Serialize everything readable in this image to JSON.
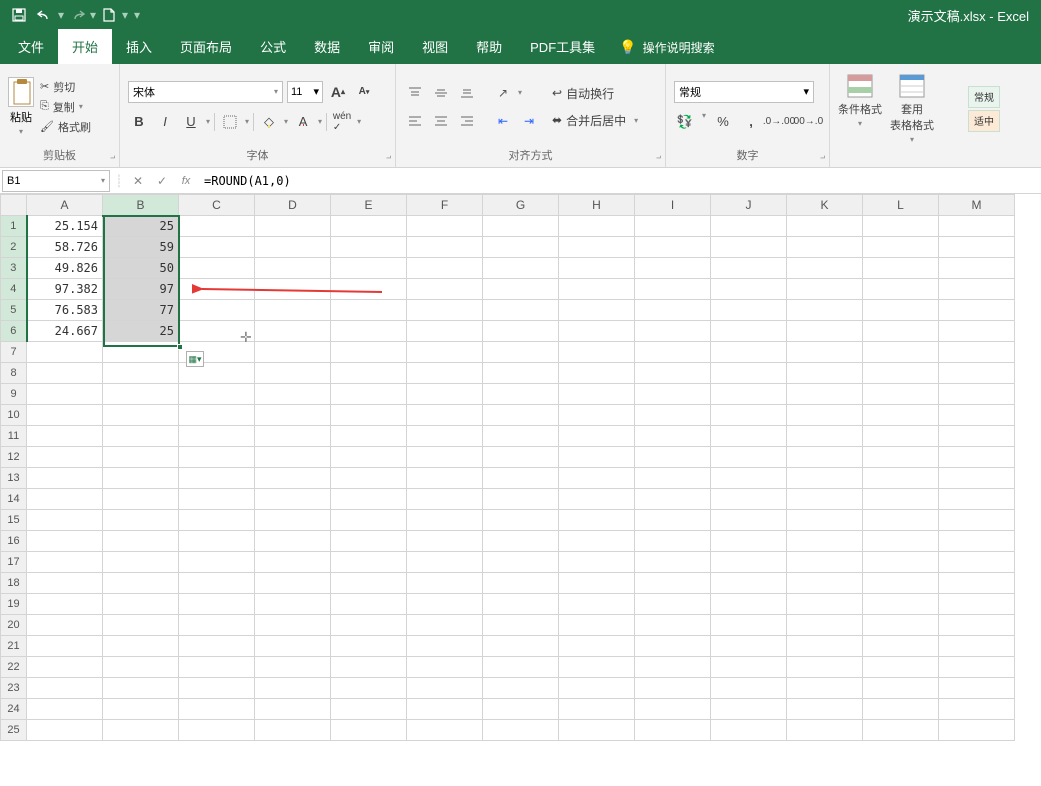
{
  "titlebar": {
    "doc_title": "演示文稿.xlsx  -  Excel"
  },
  "tabs": {
    "file": "文件",
    "home": "开始",
    "insert": "插入",
    "layout": "页面布局",
    "formulas": "公式",
    "data": "数据",
    "review": "审阅",
    "view": "视图",
    "help": "帮助",
    "pdf": "PDF工具集",
    "tell_me": "操作说明搜索"
  },
  "ribbon": {
    "clipboard": {
      "label": "剪贴板",
      "paste": "粘贴",
      "cut": "剪切",
      "copy": "复制",
      "painter": "格式刷"
    },
    "font": {
      "label": "字体",
      "name": "宋体",
      "size": "11"
    },
    "alignment": {
      "label": "对齐方式",
      "wrap": "自动换行",
      "merge": "合并后居中"
    },
    "number": {
      "label": "数字",
      "format": "常规"
    },
    "styles": {
      "cond": "条件格式",
      "table": "套用\n表格格式",
      "quick_a": "常规",
      "quick_b": "适中"
    }
  },
  "namebox": "B1",
  "formula": "=ROUND(A1,0)",
  "columns": [
    "A",
    "B",
    "C",
    "D",
    "E",
    "F",
    "G",
    "H",
    "I",
    "J",
    "K",
    "L",
    "M"
  ],
  "rows": 25,
  "cells": {
    "A": [
      "25.154",
      "58.726",
      "49.826",
      "97.382",
      "76.583",
      "24.667"
    ],
    "B": [
      "25",
      "59",
      "50",
      "97",
      "77",
      "25"
    ]
  },
  "selection": {
    "col": "B",
    "r1": 1,
    "r2": 6
  }
}
